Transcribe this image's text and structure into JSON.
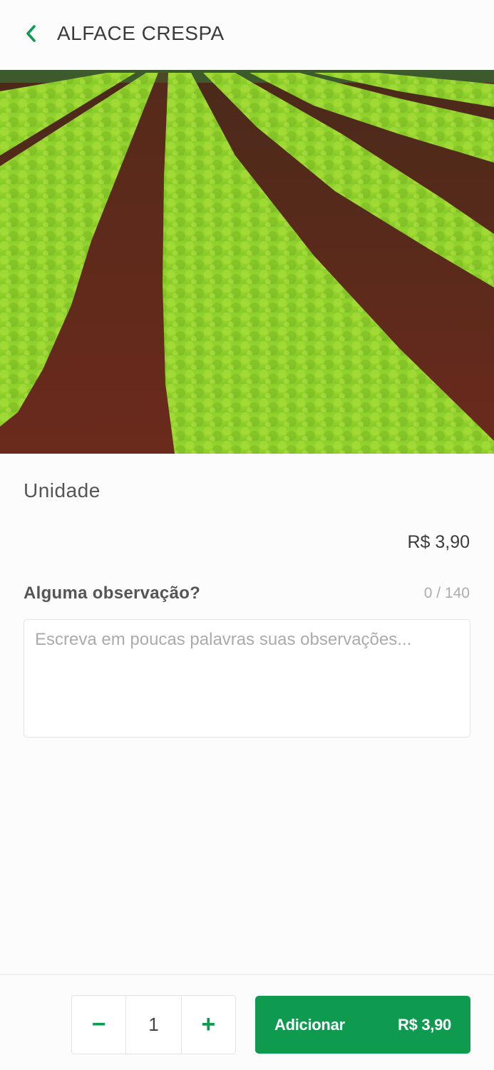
{
  "header": {
    "title": "ALFACE CRESPA",
    "back_icon": "chevron-left-icon"
  },
  "product": {
    "unit_label": "Unidade",
    "price": "R$ 3,90"
  },
  "observation": {
    "title": "Alguma observação?",
    "counter": "0 / 140",
    "placeholder": "Escreva em poucas palavras suas observações...",
    "value": ""
  },
  "footer": {
    "decrement_label": "−",
    "quantity": "1",
    "increment_label": "+",
    "add_label": "Adicionar",
    "add_price": "R$ 3,90"
  },
  "colors": {
    "accent": "#0e9a4f",
    "text_dark": "#3b3b3b",
    "muted": "#adadad"
  }
}
